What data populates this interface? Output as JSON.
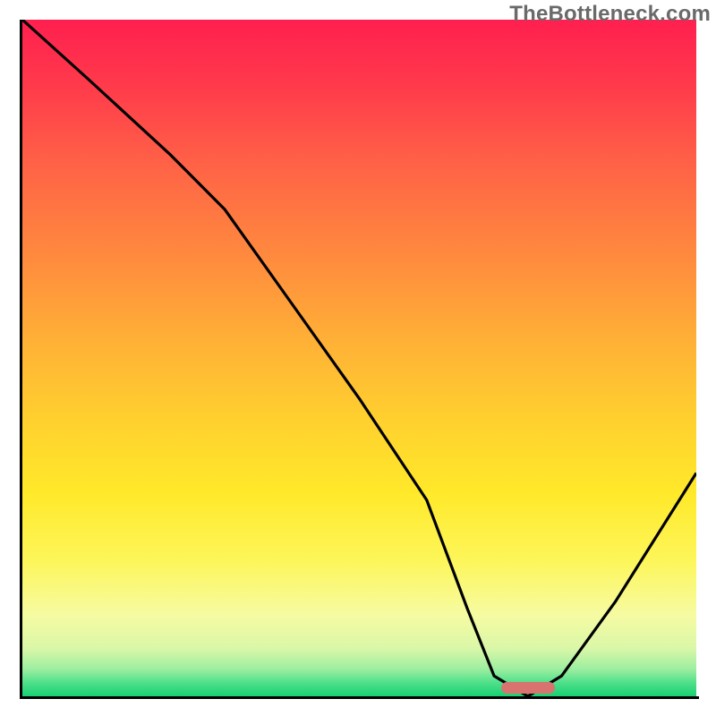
{
  "watermark": "TheBottleneck.com",
  "chart_data": {
    "type": "line",
    "title": "",
    "xlabel": "",
    "ylabel": "",
    "xlim": [
      0,
      100
    ],
    "ylim": [
      0,
      100
    ],
    "x": [
      0,
      10,
      22,
      30,
      40,
      50,
      60,
      66,
      70,
      75,
      80,
      88,
      100
    ],
    "values": [
      100,
      91,
      80,
      72,
      58,
      44,
      29,
      13,
      3,
      0,
      3,
      14,
      33
    ],
    "optimum_x": 75,
    "optimum_width": 8,
    "annotations": [],
    "colors": {
      "gradient_top": "#ff1f4f",
      "gradient_bottom": "#18cf73",
      "curve": "#000000",
      "optimum_marker": "#d9736f",
      "axes": "#000000"
    }
  }
}
